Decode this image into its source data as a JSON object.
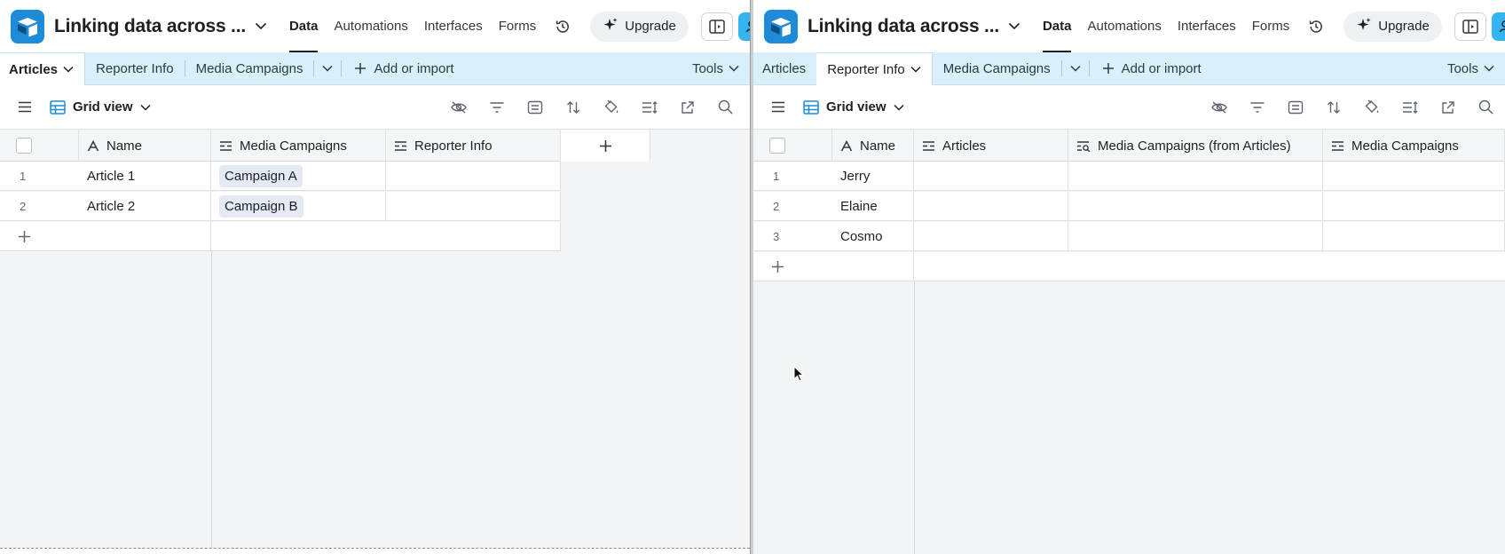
{
  "left": {
    "title": "Linking data across ...",
    "nav": [
      "Data",
      "Automations",
      "Interfaces",
      "Forms"
    ],
    "upgrade_label": "Upgrade",
    "tabs": [
      "Articles",
      "Reporter Info",
      "Media Campaigns"
    ],
    "add_import_label": "Add or import",
    "tools_label": "Tools",
    "view_name": "Grid view",
    "columns": [
      "Name",
      "Media Campaigns",
      "Reporter Info"
    ],
    "rows": [
      {
        "num": "1",
        "name": "Article 1",
        "media": "Campaign A",
        "reporter": ""
      },
      {
        "num": "2",
        "name": "Article 2",
        "media": "Campaign B",
        "reporter": ""
      }
    ],
    "add_column_symbol": "+",
    "add_row_symbol": "+"
  },
  "right": {
    "title": "Linking data across ...",
    "nav": [
      "Data",
      "Automations",
      "Interfaces",
      "Forms"
    ],
    "upgrade_label": "Upgrade",
    "tabs": [
      "Articles",
      "Reporter Info",
      "Media Campaigns"
    ],
    "add_import_label": "Add or import",
    "tools_label": "Tools",
    "view_name": "Grid view",
    "columns": [
      "Name",
      "Articles",
      "Media Campaigns (from Articles)",
      "Media Campaigns"
    ],
    "rows": [
      {
        "num": "1",
        "name": "Jerry"
      },
      {
        "num": "2",
        "name": "Elaine"
      },
      {
        "num": "3",
        "name": "Cosmo"
      }
    ],
    "add_row_symbol": "+"
  },
  "icons": {
    "logo": "airtable-logo-icon",
    "history": "history-icon",
    "upgrade": "sparkle-icon",
    "interface": "interface-preview-icon",
    "share": "collaborators-icon",
    "menu": "hamburger-menu-icon",
    "grid": "grid-view-icon",
    "hide": "hide-fields-icon",
    "filter": "filter-icon",
    "group": "group-icon",
    "sort": "sort-icon",
    "color": "color-icon",
    "row_height": "row-height-icon",
    "share_view": "share-view-icon",
    "search": "search-icon"
  },
  "colors": {
    "tabs_bar": "#d9f0fa",
    "logo": "#1d8bd8",
    "share_button": "#34b4f1",
    "linked_record_pill": "#e4e9f3"
  }
}
